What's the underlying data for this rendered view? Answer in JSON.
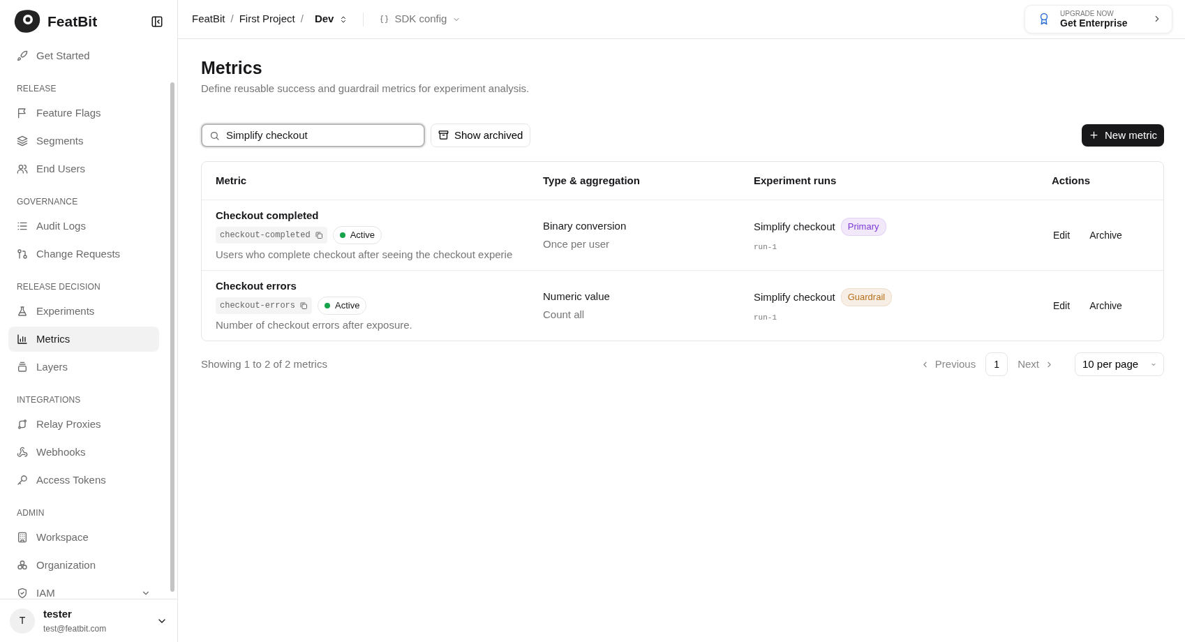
{
  "sidebar": {
    "brand": "FeatBit",
    "top_items": [
      {
        "label": "Get Started",
        "selected": false
      }
    ],
    "sections": [
      {
        "title": "RELEASE",
        "items": [
          {
            "label": "Feature Flags",
            "selected": false
          },
          {
            "label": "Segments",
            "selected": false
          },
          {
            "label": "End Users",
            "selected": false
          }
        ]
      },
      {
        "title": "GOVERNANCE",
        "items": [
          {
            "label": "Audit Logs",
            "selected": false
          },
          {
            "label": "Change Requests",
            "selected": false
          }
        ]
      },
      {
        "title": "RELEASE DECISION",
        "items": [
          {
            "label": "Experiments",
            "selected": false
          },
          {
            "label": "Metrics",
            "selected": true
          },
          {
            "label": "Layers",
            "selected": false
          }
        ]
      },
      {
        "title": "INTEGRATIONS",
        "items": [
          {
            "label": "Relay Proxies",
            "selected": false
          },
          {
            "label": "Webhooks",
            "selected": false
          },
          {
            "label": "Access Tokens",
            "selected": false
          }
        ]
      },
      {
        "title": "ADMIN",
        "items": [
          {
            "label": "Workspace",
            "selected": false
          },
          {
            "label": "Organization",
            "selected": false
          },
          {
            "label": "IAM",
            "selected": false,
            "expanded": false
          }
        ]
      }
    ],
    "user": {
      "initial": "T",
      "name": "tester",
      "email": "test@featbit.com"
    }
  },
  "topbar": {
    "breadcrumb": [
      "FeatBit",
      "/",
      "First Project",
      "/",
      "Dev"
    ],
    "sdk_config": "SDK config",
    "upgrade": {
      "caption": "UPGRADE NOW",
      "label": "Get Enterprise"
    }
  },
  "page": {
    "title": "Metrics",
    "subtitle": "Define reusable success and guardrail metrics for experiment analysis.",
    "search": {
      "value": "Simplify checkout"
    },
    "show_archived": "Show archived",
    "new_button": "New metric"
  },
  "table": {
    "columns": [
      "Metric",
      "Type & aggregation",
      "Experiment runs",
      "Actions"
    ],
    "rows": [
      {
        "name": "Checkout completed",
        "key": "checkout-completed",
        "status": {
          "label": "Active",
          "color": "#16a34a"
        },
        "description": "Users who complete checkout after seeing the checkout experie",
        "type": "Binary conversion",
        "aggregation": "Once per user",
        "run": "Simplify checkout",
        "role": {
          "label": "Primary",
          "color": "#7e3bd6"
        },
        "run_id": "run-1",
        "actions": [
          "Edit",
          "Archive"
        ]
      },
      {
        "name": "Checkout errors",
        "key": "checkout-errors",
        "status": {
          "label": "Active",
          "color": "#16a34a"
        },
        "description": "Number of checkout errors after exposure.",
        "type": "Numeric value",
        "aggregation": "Count all",
        "run": "Simplify checkout",
        "role": {
          "label": "Guardrail",
          "color": "#b7701c"
        },
        "run_id": "run-1",
        "actions": [
          "Edit",
          "Archive"
        ]
      }
    ]
  },
  "pagination": {
    "summary": "Showing 1 to 2 of 2 metrics",
    "previous": "Previous",
    "pages": [
      {
        "label": "1",
        "selected": true
      }
    ],
    "next": "Next",
    "per_page": "10 per page"
  }
}
